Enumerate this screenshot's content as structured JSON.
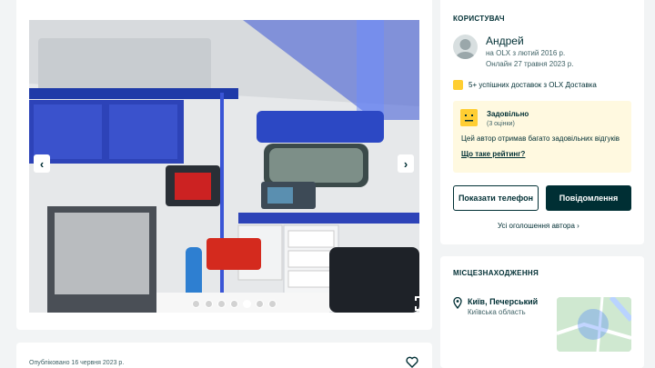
{
  "gallery": {
    "prev_arrow": "‹",
    "next_arrow": "›",
    "dot_count": 7,
    "active_dot": 4
  },
  "listing": {
    "published": "Опубліковано 16 червня 2023 р."
  },
  "user": {
    "section_title": "КОРИСТУВАЧ",
    "name": "Андрей",
    "member_since": "на OLX з лютий 2016 р.",
    "last_online": "Онлайн 27 травня 2023 р.",
    "deliveries": "5+ успішних доставок з OLX Доставка",
    "rating": {
      "label": "Задовільно",
      "count": "(3 оцінки)",
      "description": "Цей автор отримав багато задовільних відгуків",
      "link": "Що таке рейтинг?"
    },
    "phone_button": "Показати телефон",
    "message_button": "Повідомлення",
    "all_ads_link": "Усі оголошення автора"
  },
  "location": {
    "section_title": "МІСЦЕЗНАХОДЖЕННЯ",
    "city": "Київ, Печерський",
    "region": "Київська область"
  },
  "colors": {
    "brand_dark": "#002f34",
    "accent_yellow": "#ffce32",
    "rating_bg": "#fff9e0"
  }
}
